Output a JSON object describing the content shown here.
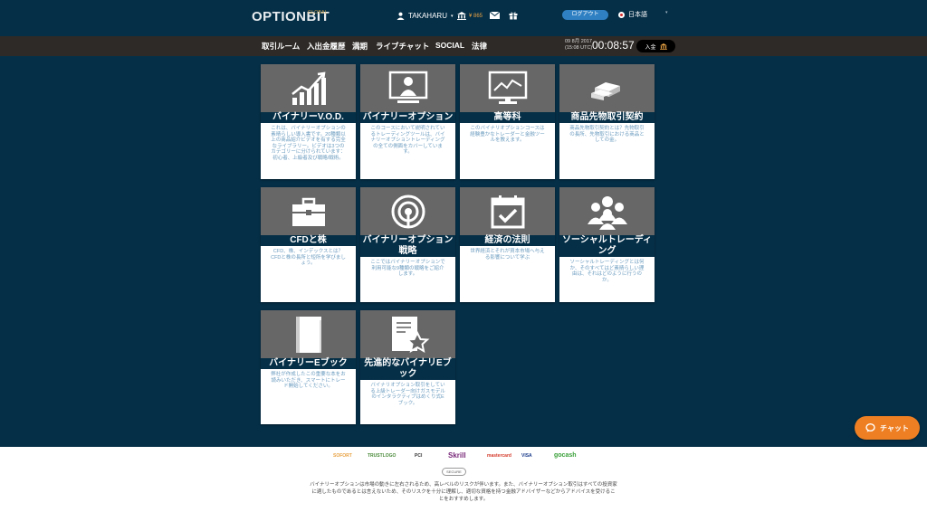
{
  "header": {
    "logo_text": "OPTIONBIT",
    "logo_sub": "GLOBAL",
    "username": "TAKAHARU",
    "balance": "¥ 865",
    "logout_label": "ログアウト",
    "language": "日本語",
    "lang_caret": "▾"
  },
  "nav": {
    "items": [
      "取引ルーム",
      "入出金履歴",
      "満期",
      "ライブチャット",
      "SOCIAL",
      "法律"
    ],
    "date_line1": "09 8月 2017",
    "date_line2": "(15:08 UTC)",
    "clock": "00:08:57",
    "deposit_label": "入金"
  },
  "cards": [
    {
      "title": "バイナリーV.O.D.",
      "desc": "これは、バイナリーオプションの素晴らしい導入書です。20種類以上の商品紹介ビデオを有する完全なライブラリー。ビデオは3つのカテゴリーに分けられています：初心者、上級者及び戦略/戦術。"
    },
    {
      "title": "バイナリーオプション",
      "desc": "このコースにおいて説明されているトレーディングツールは、バイナリーオプショントレーディングの全ての側面をカバーしています。"
    },
    {
      "title": "高等科",
      "desc": "このバイナリオプションコースは経験豊かなトレーダーと金融ツールを教えます。"
    },
    {
      "title": "商品先物取引契約",
      "desc": "商品先物取引契約とは？先物取引の長所、先物取引における商品としての金。"
    },
    {
      "title": "CFDと株",
      "desc": "CFD、株、インデックスとは？ CFDと株の長所と短所を学びましょう。"
    },
    {
      "title": "バイナリーオプション戦略",
      "desc": "ここではバイナリーオプションで利用可能な9種類の戦略をご紹介します。"
    },
    {
      "title": "経済の法則",
      "desc": "世界経済とそれが資本市場へ与える影響について学ぶ"
    },
    {
      "title": "ソーシャルトレーディング",
      "desc": "ソーシャルトレーディングとは何か、そのすべてはど素晴らしい理由は、それはどのように行うのか。"
    },
    {
      "title": "バイナリーEブック",
      "desc": "弊社が作成したこの重要な本をお読みいただき、スマートにトレード開始してください。"
    },
    {
      "title": "先進的なバイナリEブック",
      "desc": "バイナリオプション取引をしている上級トレーダー向けガスモデルのインタラクティブはめくり式Eブック。"
    }
  ],
  "chat": {
    "label": "チャット"
  },
  "footer": {
    "payments": [
      "SOFORT",
      "TRUSTLOGO",
      "PCI",
      "Skrill",
      "mastercard",
      "VISA",
      "gocash"
    ],
    "seal": "SECURE",
    "disclaimer": "バイナリーオプションは市場の動きに左右されるため、高レベルのリスクが伴います。また、バイナリーオプション取引はすべての投資家に適したものであるとは言えないため、そのリスクを十分に理解し、適切な資格を持つ金融アドバイザーなどからアドバイスを受けることをおすすめします。"
  },
  "colors": {
    "bg": "#052f47",
    "nav": "#2e2a27",
    "card_img": "#676767",
    "accent": "#ee7f22",
    "logout": "#2f80c3",
    "desc": "#6a9bbf"
  }
}
